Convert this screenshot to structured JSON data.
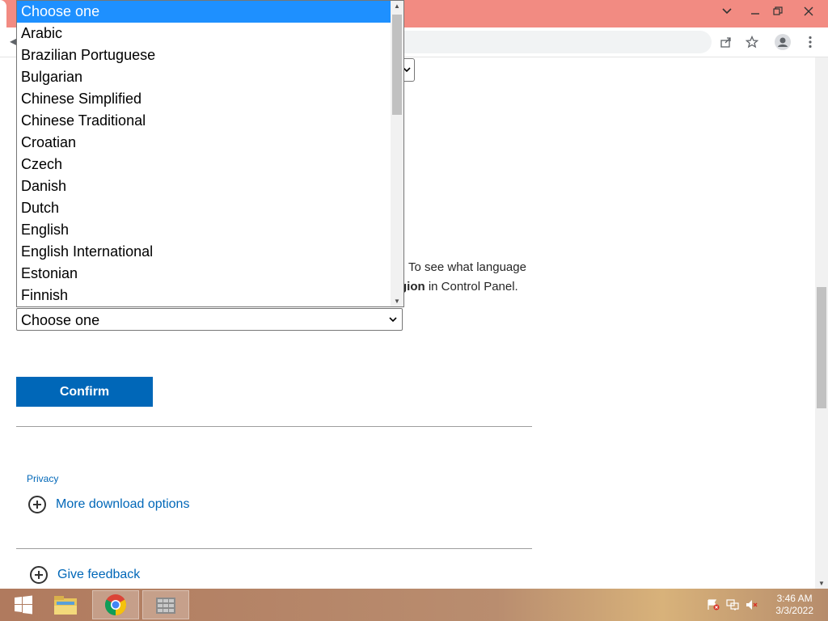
{
  "browser": {
    "window_controls": [
      "chevron-down-icon",
      "minimize-icon",
      "restore-icon",
      "close-icon"
    ],
    "toolbar_icons": [
      "share-icon",
      "star-icon",
      "profile-icon",
      "kebab-menu-icon"
    ]
  },
  "page": {
    "info_line1": "To see what language",
    "info_line2_bold": "gion",
    "info_line2_rest": " in Control Panel.",
    "select": {
      "value": "Choose one",
      "options": [
        "Choose one",
        "Arabic",
        "Brazilian Portuguese",
        "Bulgarian",
        "Chinese Simplified",
        "Chinese Traditional",
        "Croatian",
        "Czech",
        "Danish",
        "Dutch",
        "English",
        "English International",
        "Estonian",
        "Finnish"
      ],
      "selected_index": 0
    },
    "confirm_label": "Confirm",
    "privacy_label": "Privacy",
    "more_download_label": "More download options",
    "feedback_label": "Give feedback"
  },
  "taskbar": {
    "apps": [
      "start-icon",
      "file-explorer-icon",
      "chrome-icon",
      "app-icon"
    ],
    "time": "3:46 AM",
    "date": "3/3/2022"
  },
  "colors": {
    "titlebar": "#f28b82",
    "accent": "#0067b8",
    "selected_option": "#1e90ff"
  }
}
